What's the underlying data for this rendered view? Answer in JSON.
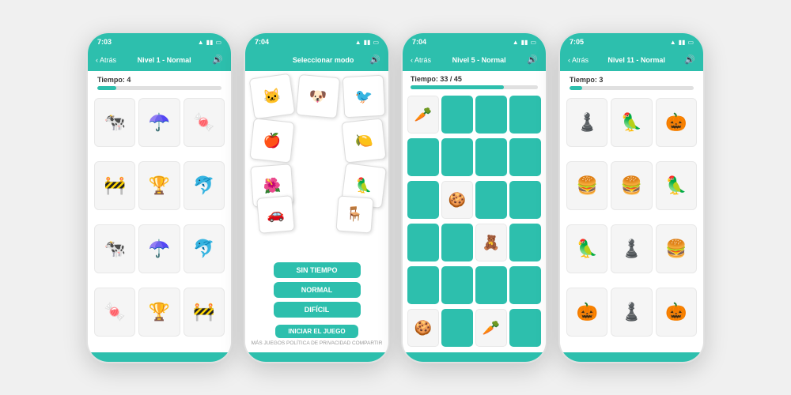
{
  "phones": [
    {
      "id": "phone1",
      "status_time": "7:03",
      "header": {
        "back_label": "Atrás",
        "title": "Nivel 1 - Normal",
        "show_sound": true
      },
      "timer_label": "Tiempo: 4",
      "timer_percent": 15,
      "screen_type": "image_grid",
      "grid_items": [
        "🐄",
        "☂️",
        "🍬",
        "🚧",
        "🏆",
        "🐬",
        "🐄",
        "☂️",
        "🐬",
        "🍬",
        "🏆",
        "🚧"
      ]
    },
    {
      "id": "phone2",
      "status_time": "7:04",
      "header": {
        "back_label": null,
        "title": "Seleccionar modo",
        "show_sound": true
      },
      "screen_type": "mode_select",
      "scattered_cards": [
        "🐱",
        "🐶",
        "🐦",
        "🍎",
        "🍋",
        "🌺",
        "🦜",
        "🚗",
        "🪑"
      ],
      "buttons": [
        "SIN TIEMPO",
        "NORMAL",
        "DIFÍCIL"
      ],
      "start_label": "INICIAR EL JUEGO",
      "bottom_links": "MÁS JUEGOS   POLÍTICA DE PRIVACIDAD   COMPARTIR"
    },
    {
      "id": "phone3",
      "status_time": "7:04",
      "header": {
        "back_label": "Atrás",
        "title": "Nivel 5 - Normal",
        "show_sound": true
      },
      "timer_label": "Tiempo: 33 / 45",
      "timer_percent": 73,
      "screen_type": "memory_grid",
      "grid_cols": 4,
      "grid_items": [
        {
          "type": "revealed",
          "emoji": "🥕"
        },
        {
          "type": "hidden"
        },
        {
          "type": "hidden"
        },
        {
          "type": "hidden"
        },
        {
          "type": "hidden"
        },
        {
          "type": "hidden"
        },
        {
          "type": "hidden"
        },
        {
          "type": "hidden"
        },
        {
          "type": "hidden"
        },
        {
          "type": "revealed",
          "emoji": "🍪"
        },
        {
          "type": "hidden"
        },
        {
          "type": "hidden"
        },
        {
          "type": "hidden"
        },
        {
          "type": "hidden"
        },
        {
          "type": "revealed",
          "emoji": "🧸"
        },
        {
          "type": "hidden"
        },
        {
          "type": "hidden"
        },
        {
          "type": "hidden"
        },
        {
          "type": "hidden"
        },
        {
          "type": "hidden"
        },
        {
          "type": "revealed",
          "emoji": "🍪"
        },
        {
          "type": "hidden"
        },
        {
          "type": "revealed",
          "emoji": "🥕"
        },
        {
          "type": "hidden"
        }
      ]
    },
    {
      "id": "phone4",
      "status_time": "7:05",
      "header": {
        "back_label": "Atrás",
        "title": "Nivel 11 - Normal",
        "show_sound": true
      },
      "timer_label": "Tiempo: 3",
      "timer_percent": 10,
      "screen_type": "image_grid",
      "grid_items": [
        "♟️",
        "🦜",
        "🎃",
        "🍔",
        "🍔",
        "🦜",
        "🦜",
        "♟️",
        "🍔",
        "🎃",
        "♟️",
        "🎃"
      ]
    }
  ]
}
